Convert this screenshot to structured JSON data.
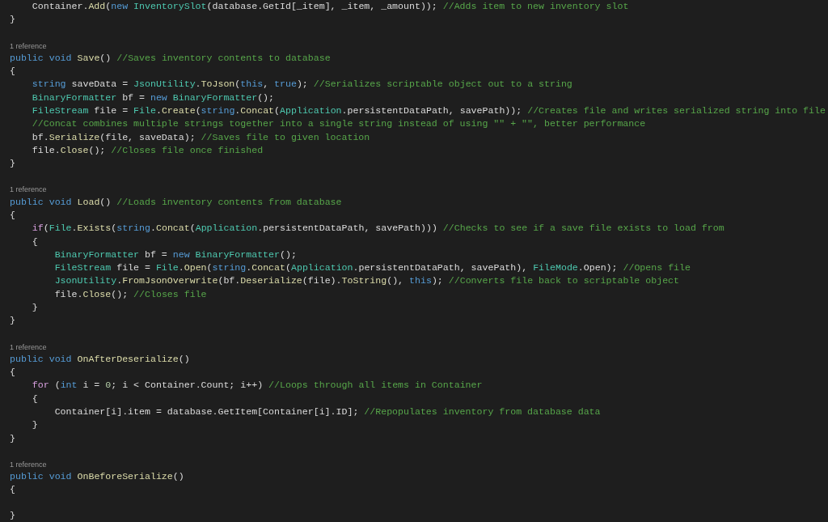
{
  "lines": [
    {
      "kind": "code",
      "tokens": [
        {
          "kind": "plain",
          "text": "    Container."
        },
        {
          "kind": "method",
          "text": "Add"
        },
        {
          "kind": "plain",
          "text": "("
        },
        {
          "kind": "keyword",
          "text": "new"
        },
        {
          "kind": "type",
          "text": " InventorySlot"
        },
        {
          "kind": "plain",
          "text": "(database.GetId[_item], _item, _amount)); "
        },
        {
          "kind": "comment",
          "text": "//Adds item to new inventory slot"
        }
      ]
    },
    {
      "kind": "code",
      "tokens": [
        {
          "kind": "plain",
          "text": "}"
        }
      ]
    },
    {
      "kind": "blank"
    },
    {
      "kind": "codelens",
      "text": "1 reference"
    },
    {
      "kind": "code",
      "tokens": [
        {
          "kind": "keyword",
          "text": "public"
        },
        {
          "kind": "keyword",
          "text": " void"
        },
        {
          "kind": "method",
          "text": " Save"
        },
        {
          "kind": "plain",
          "text": "() "
        },
        {
          "kind": "comment",
          "text": "//Saves inventory contents to database"
        }
      ]
    },
    {
      "kind": "code",
      "tokens": [
        {
          "kind": "plain",
          "text": "{"
        }
      ]
    },
    {
      "kind": "code",
      "tokens": [
        {
          "kind": "keyword",
          "text": "    string"
        },
        {
          "kind": "plain",
          "text": " saveData = "
        },
        {
          "kind": "type",
          "text": "JsonUtility"
        },
        {
          "kind": "plain",
          "text": "."
        },
        {
          "kind": "method",
          "text": "ToJson"
        },
        {
          "kind": "plain",
          "text": "("
        },
        {
          "kind": "keyword",
          "text": "this"
        },
        {
          "kind": "plain",
          "text": ", "
        },
        {
          "kind": "keyword",
          "text": "true"
        },
        {
          "kind": "plain",
          "text": "); "
        },
        {
          "kind": "comment",
          "text": "//Serializes scriptable object out to a string"
        }
      ]
    },
    {
      "kind": "code",
      "tokens": [
        {
          "kind": "type",
          "text": "    BinaryFormatter"
        },
        {
          "kind": "plain",
          "text": " bf = "
        },
        {
          "kind": "keyword",
          "text": "new"
        },
        {
          "kind": "type",
          "text": " BinaryFormatter"
        },
        {
          "kind": "plain",
          "text": "();"
        }
      ]
    },
    {
      "kind": "code",
      "tokens": [
        {
          "kind": "type",
          "text": "    FileStream"
        },
        {
          "kind": "plain",
          "text": " file = "
        },
        {
          "kind": "type",
          "text": "File"
        },
        {
          "kind": "plain",
          "text": "."
        },
        {
          "kind": "method",
          "text": "Create"
        },
        {
          "kind": "plain",
          "text": "("
        },
        {
          "kind": "keyword",
          "text": "string"
        },
        {
          "kind": "plain",
          "text": "."
        },
        {
          "kind": "method",
          "text": "Concat"
        },
        {
          "kind": "plain",
          "text": "("
        },
        {
          "kind": "type",
          "text": "Application"
        },
        {
          "kind": "plain",
          "text": ".persistentDataPath, savePath)); "
        },
        {
          "kind": "comment",
          "text": "//Creates file and writes serialized string into file"
        }
      ]
    },
    {
      "kind": "code",
      "tokens": [
        {
          "kind": "comment",
          "text": "    //Concat combines multiple strings together into a single string instead of using \"\" + \"\", better performance"
        }
      ]
    },
    {
      "kind": "code",
      "tokens": [
        {
          "kind": "plain",
          "text": "    bf."
        },
        {
          "kind": "method",
          "text": "Serialize"
        },
        {
          "kind": "plain",
          "text": "(file, saveData); "
        },
        {
          "kind": "comment",
          "text": "//Saves file to given location"
        }
      ]
    },
    {
      "kind": "code",
      "tokens": [
        {
          "kind": "plain",
          "text": "    file."
        },
        {
          "kind": "method",
          "text": "Close"
        },
        {
          "kind": "plain",
          "text": "(); "
        },
        {
          "kind": "comment",
          "text": "//Closes file once finished"
        }
      ]
    },
    {
      "kind": "code",
      "tokens": [
        {
          "kind": "plain",
          "text": "}"
        }
      ]
    },
    {
      "kind": "blank"
    },
    {
      "kind": "codelens",
      "text": "1 reference"
    },
    {
      "kind": "code",
      "tokens": [
        {
          "kind": "keyword",
          "text": "public"
        },
        {
          "kind": "keyword",
          "text": " void"
        },
        {
          "kind": "method",
          "text": " Load"
        },
        {
          "kind": "plain",
          "text": "() "
        },
        {
          "kind": "comment",
          "text": "//Loads inventory contents from database"
        }
      ]
    },
    {
      "kind": "code",
      "tokens": [
        {
          "kind": "plain",
          "text": "{"
        }
      ]
    },
    {
      "kind": "code",
      "tokens": [
        {
          "kind": "control",
          "text": "    if"
        },
        {
          "kind": "plain",
          "text": "("
        },
        {
          "kind": "type",
          "text": "File"
        },
        {
          "kind": "plain",
          "text": "."
        },
        {
          "kind": "method",
          "text": "Exists"
        },
        {
          "kind": "plain",
          "text": "("
        },
        {
          "kind": "keyword",
          "text": "string"
        },
        {
          "kind": "plain",
          "text": "."
        },
        {
          "kind": "method",
          "text": "Concat"
        },
        {
          "kind": "plain",
          "text": "("
        },
        {
          "kind": "type",
          "text": "Application"
        },
        {
          "kind": "plain",
          "text": ".persistentDataPath, savePath))) "
        },
        {
          "kind": "comment",
          "text": "//Checks to see if a save file exists to load from"
        }
      ]
    },
    {
      "kind": "code",
      "tokens": [
        {
          "kind": "plain",
          "text": "    {"
        }
      ]
    },
    {
      "kind": "code",
      "tokens": [
        {
          "kind": "type",
          "text": "        BinaryFormatter"
        },
        {
          "kind": "plain",
          "text": " bf = "
        },
        {
          "kind": "keyword",
          "text": "new"
        },
        {
          "kind": "type",
          "text": " BinaryFormatter"
        },
        {
          "kind": "plain",
          "text": "();"
        }
      ]
    },
    {
      "kind": "code",
      "tokens": [
        {
          "kind": "type",
          "text": "        FileStream"
        },
        {
          "kind": "plain",
          "text": " file = "
        },
        {
          "kind": "type",
          "text": "File"
        },
        {
          "kind": "plain",
          "text": "."
        },
        {
          "kind": "method",
          "text": "Open"
        },
        {
          "kind": "plain",
          "text": "("
        },
        {
          "kind": "keyword",
          "text": "string"
        },
        {
          "kind": "plain",
          "text": "."
        },
        {
          "kind": "method",
          "text": "Concat"
        },
        {
          "kind": "plain",
          "text": "("
        },
        {
          "kind": "type",
          "text": "Application"
        },
        {
          "kind": "plain",
          "text": ".persistentDataPath, savePath), "
        },
        {
          "kind": "type",
          "text": "FileMode"
        },
        {
          "kind": "plain",
          "text": ".Open); "
        },
        {
          "kind": "comment",
          "text": "//Opens file"
        }
      ]
    },
    {
      "kind": "code",
      "tokens": [
        {
          "kind": "type",
          "text": "        JsonUtility"
        },
        {
          "kind": "plain",
          "text": "."
        },
        {
          "kind": "method",
          "text": "FromJsonOverwrite"
        },
        {
          "kind": "plain",
          "text": "(bf."
        },
        {
          "kind": "method",
          "text": "Deserialize"
        },
        {
          "kind": "plain",
          "text": "(file)."
        },
        {
          "kind": "method",
          "text": "ToString"
        },
        {
          "kind": "plain",
          "text": "(), "
        },
        {
          "kind": "keyword",
          "text": "this"
        },
        {
          "kind": "plain",
          "text": "); "
        },
        {
          "kind": "comment",
          "text": "//Converts file back to scriptable object"
        }
      ]
    },
    {
      "kind": "code",
      "tokens": [
        {
          "kind": "plain",
          "text": "        file."
        },
        {
          "kind": "method",
          "text": "Close"
        },
        {
          "kind": "plain",
          "text": "(); "
        },
        {
          "kind": "comment",
          "text": "//Closes file"
        }
      ]
    },
    {
      "kind": "code",
      "tokens": [
        {
          "kind": "plain",
          "text": "    }"
        }
      ]
    },
    {
      "kind": "code",
      "tokens": [
        {
          "kind": "plain",
          "text": "}"
        }
      ]
    },
    {
      "kind": "blank"
    },
    {
      "kind": "codelens",
      "text": "1 reference"
    },
    {
      "kind": "code",
      "tokens": [
        {
          "kind": "keyword",
          "text": "public"
        },
        {
          "kind": "keyword",
          "text": " void"
        },
        {
          "kind": "method",
          "text": " OnAfterDeserialize"
        },
        {
          "kind": "plain",
          "text": "()"
        }
      ]
    },
    {
      "kind": "code",
      "tokens": [
        {
          "kind": "plain",
          "text": "{"
        }
      ]
    },
    {
      "kind": "code",
      "tokens": [
        {
          "kind": "control",
          "text": "    for"
        },
        {
          "kind": "plain",
          "text": " ("
        },
        {
          "kind": "keyword",
          "text": "int"
        },
        {
          "kind": "plain",
          "text": " i = "
        },
        {
          "kind": "number",
          "text": "0"
        },
        {
          "kind": "plain",
          "text": "; i < Container.Count; i++) "
        },
        {
          "kind": "comment",
          "text": "//Loops through all items in Container"
        }
      ]
    },
    {
      "kind": "code",
      "tokens": [
        {
          "kind": "plain",
          "text": "    {"
        }
      ]
    },
    {
      "kind": "code",
      "tokens": [
        {
          "kind": "plain",
          "text": "        Container[i].item = database.GetItem[Container[i].ID]; "
        },
        {
          "kind": "comment",
          "text": "//Repopulates inventory from database data"
        }
      ]
    },
    {
      "kind": "code",
      "tokens": [
        {
          "kind": "plain",
          "text": "    }"
        }
      ]
    },
    {
      "kind": "code",
      "tokens": [
        {
          "kind": "plain",
          "text": "}"
        }
      ]
    },
    {
      "kind": "blank"
    },
    {
      "kind": "codelens",
      "text": "1 reference"
    },
    {
      "kind": "code",
      "tokens": [
        {
          "kind": "keyword",
          "text": "public"
        },
        {
          "kind": "keyword",
          "text": " void"
        },
        {
          "kind": "method",
          "text": " OnBeforeSerialize"
        },
        {
          "kind": "plain",
          "text": "()"
        }
      ]
    },
    {
      "kind": "code",
      "tokens": [
        {
          "kind": "plain",
          "text": "{"
        }
      ]
    },
    {
      "kind": "blank"
    },
    {
      "kind": "code",
      "tokens": [
        {
          "kind": "plain",
          "text": "}"
        }
      ]
    }
  ]
}
